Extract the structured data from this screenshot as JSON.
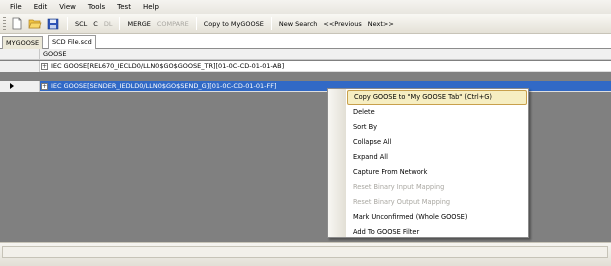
{
  "menubar": {
    "items": [
      "File",
      "Edit",
      "View",
      "Tools",
      "Test",
      "Help"
    ]
  },
  "toolbar": {
    "icons": [
      "new-file-icon",
      "open-folder-icon",
      "save-icon"
    ],
    "buttons": [
      {
        "label": "SCL",
        "enabled": true
      },
      {
        "label": "C",
        "enabled": true
      },
      {
        "label": "DL",
        "enabled": false
      },
      {
        "label": "MERGE",
        "enabled": true
      },
      {
        "label": "COMPARE",
        "enabled": false
      },
      {
        "label": "Copy to MyGOOSE",
        "enabled": true
      },
      {
        "label": "New Search",
        "enabled": true
      },
      {
        "label": "<<Previous",
        "enabled": true
      },
      {
        "label": "Next>>",
        "enabled": true
      }
    ]
  },
  "tabs": [
    {
      "label": "MYGOOSE",
      "active": false
    },
    {
      "label": "SCD File.scd",
      "active": true
    }
  ],
  "grid": {
    "column_header": "GOOSE",
    "rows": [
      {
        "text": "IEC GOOSE[REL670_IECLD0/LLN0$GO$GOOSE_TR][01-0C-CD-01-01-AB]",
        "selected": false
      },
      {
        "text": "IEC GOOSE[SENDER_IEDLD0/LLN0$GO$SEND_G][01-0C-CD-01-01-FF]",
        "selected": true
      }
    ]
  },
  "context_menu": {
    "items": [
      {
        "label": "Copy GOOSE to \"My GOOSE Tab\" (Ctrl+G)",
        "enabled": true,
        "highlighted": true
      },
      {
        "label": "Delete",
        "enabled": true
      },
      {
        "label": "Sort By",
        "enabled": true
      },
      {
        "label": "Collapse All",
        "enabled": true
      },
      {
        "label": "Expand All",
        "enabled": true
      },
      {
        "label": "Capture From Network",
        "enabled": true
      },
      {
        "label": "Reset Binary Input Mapping",
        "enabled": false
      },
      {
        "label": "Reset Binary Output Mapping",
        "enabled": false
      },
      {
        "label": "Mark Unconfirmed (Whole GOOSE)",
        "enabled": true
      },
      {
        "label": "Add To GOOSE Filter",
        "enabled": true
      }
    ]
  },
  "colors": {
    "selection": "#3169c6",
    "menu_highlight": "#f6eec2",
    "grid_background": "#808080"
  }
}
